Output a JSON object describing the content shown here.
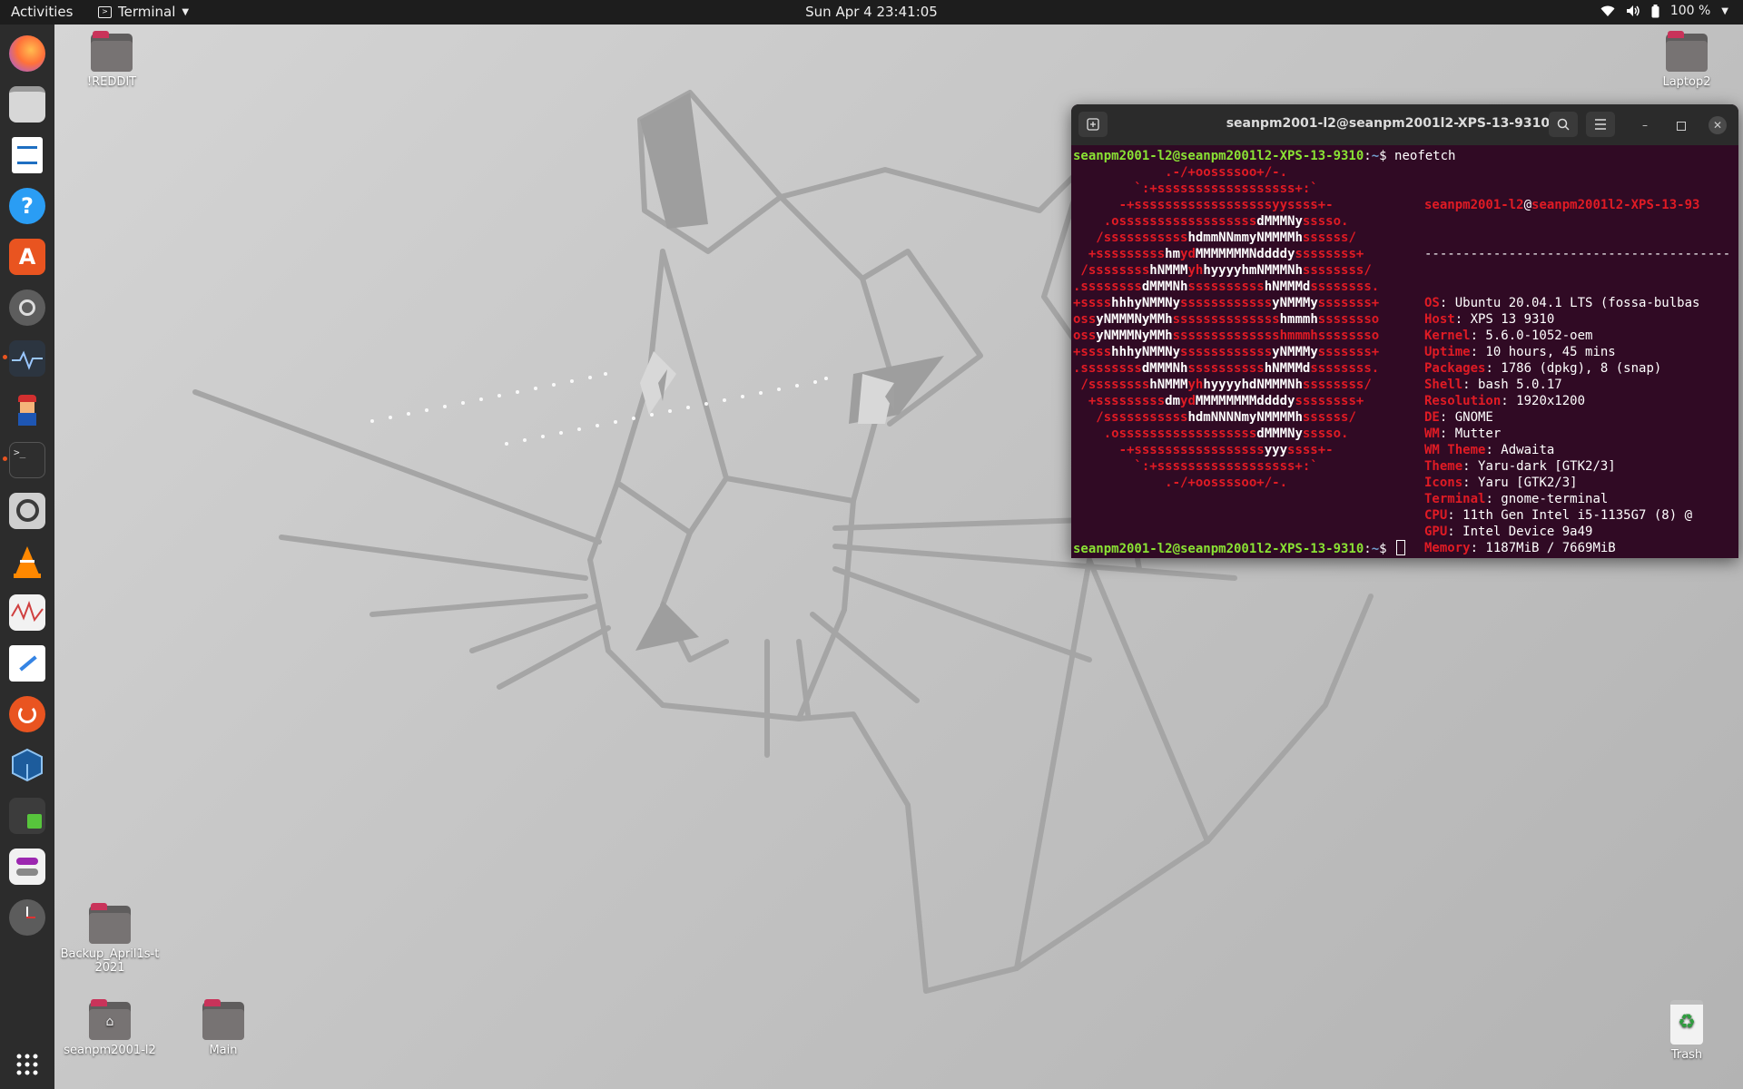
{
  "topbar": {
    "activities": "Activities",
    "app_name": "Terminal",
    "clock": "Sun Apr 4  23:41:05",
    "battery": "100 %"
  },
  "dock": {
    "apps": [
      "firefox-icon",
      "files-icon",
      "writer-icon",
      "help-icon",
      "software-icon",
      "settings-icon",
      "system-monitor-icon",
      "game-icon",
      "terminal-icon",
      "magnifier-icon",
      "vlc-icon",
      "stocks-icon",
      "text-editor-icon",
      "updates-icon",
      "virtualbox-icon",
      "extension-icon",
      "tweaks-icon",
      "clock-icon"
    ],
    "show_apps": "apps-grid-icon"
  },
  "desktop": {
    "icons": {
      "reddit": "!REDDIT",
      "laptop2": "Laptop2",
      "backup": "Backup_April1s-t2021",
      "home": "seanpm2001-l2",
      "main": "Main",
      "trash": "Trash"
    }
  },
  "terminal": {
    "title": "seanpm2001-l2@seanpm2001l2-XPS-13-9310: ~",
    "prompt_user": "seanpm2001-l2@seanpm2001l2-XPS-13-9310",
    "prompt_path": "~",
    "command": "neofetch",
    "header_user": "seanpm2001-l2",
    "header_at": "@",
    "header_host": "seanpm2001l2-XPS-13-93",
    "separator": "----------------------------------------",
    "info": [
      {
        "key": "OS",
        "value": ": Ubuntu 20.04.1 LTS (fossa-bulbas"
      },
      {
        "key": "Host",
        "value": ": XPS 13 9310"
      },
      {
        "key": "Kernel",
        "value": ": 5.6.0-1052-oem"
      },
      {
        "key": "Uptime",
        "value": ": 10 hours, 45 mins"
      },
      {
        "key": "Packages",
        "value": ": 1786 (dpkg), 8 (snap)"
      },
      {
        "key": "Shell",
        "value": ": bash 5.0.17"
      },
      {
        "key": "Resolution",
        "value": ": 1920x1200"
      },
      {
        "key": "DE",
        "value": ": GNOME"
      },
      {
        "key": "WM",
        "value": ": Mutter"
      },
      {
        "key": "WM Theme",
        "value": ": Adwaita"
      },
      {
        "key": "Theme",
        "value": ": Yaru-dark [GTK2/3]"
      },
      {
        "key": "Icons",
        "value": ": Yaru [GTK2/3]"
      },
      {
        "key": "Terminal",
        "value": ": gnome-terminal"
      },
      {
        "key": "CPU",
        "value": ": 11th Gen Intel i5-1135G7 (8) @"
      },
      {
        "key": "GPU",
        "value": ": Intel Device 9a49"
      },
      {
        "key": "Memory",
        "value": ": 1187MiB / 7669MiB"
      }
    ],
    "ascii_art": [
      [
        [
          "r",
          "            .-/+oossssoo+/-."
        ]
      ],
      [
        [
          "r",
          "        `:+ssssssssssssssssss+:`"
        ]
      ],
      [
        [
          "r",
          "      -+ssssssssssssssssssyyssss+-"
        ]
      ],
      [
        [
          "r",
          "    .ossssssssssssssssss"
        ],
        [
          "w",
          "dMMMNy"
        ],
        [
          "r",
          "sssso."
        ]
      ],
      [
        [
          "r",
          "   /sssssssssss"
        ],
        [
          "w",
          "hdmmNNmmyNMMMMh"
        ],
        [
          "r",
          "ssssss/"
        ]
      ],
      [
        [
          "r",
          "  +sssssssss"
        ],
        [
          "w",
          "hm"
        ],
        [
          "r",
          "yd"
        ],
        [
          "w",
          "MMMMMMMNddddy"
        ],
        [
          "r",
          "ssssssss+"
        ]
      ],
      [
        [
          "r",
          " /ssssssss"
        ],
        [
          "w",
          "hNMMM"
        ],
        [
          "r",
          "yh"
        ],
        [
          "w",
          "hyyyyhmNMMMNh"
        ],
        [
          "r",
          "ssssssss/"
        ]
      ],
      [
        [
          "r",
          ".ssssssss"
        ],
        [
          "w",
          "dMMMNh"
        ],
        [
          "r",
          "ssssssssss"
        ],
        [
          "w",
          "hNMMMd"
        ],
        [
          "r",
          "ssssssss."
        ]
      ],
      [
        [
          "r",
          "+ssss"
        ],
        [
          "w",
          "hhhyNMMNy"
        ],
        [
          "r",
          "ssssssssssss"
        ],
        [
          "w",
          "yNMMMy"
        ],
        [
          "r",
          "sssssss+"
        ]
      ],
      [
        [
          "r",
          "oss"
        ],
        [
          "w",
          "yNMMMNyMMh"
        ],
        [
          "r",
          "ssssssssssssss"
        ],
        [
          "w",
          "hmmmh"
        ],
        [
          "r",
          "ssssssso"
        ]
      ],
      [
        [
          "r",
          "oss"
        ],
        [
          "w",
          "yNMMMNyMMh"
        ],
        [
          "r",
          "sssssssssssssshmmmhssssssso"
        ]
      ],
      [
        [
          "r",
          "+ssss"
        ],
        [
          "w",
          "hhhyNMMNy"
        ],
        [
          "r",
          "ssssssssssss"
        ],
        [
          "w",
          "yNMMMy"
        ],
        [
          "r",
          "sssssss+"
        ]
      ],
      [
        [
          "r",
          ".ssssssss"
        ],
        [
          "w",
          "dMMMNh"
        ],
        [
          "r",
          "ssssssssss"
        ],
        [
          "w",
          "hNMMMd"
        ],
        [
          "r",
          "ssssssss."
        ]
      ],
      [
        [
          "r",
          " /ssssssss"
        ],
        [
          "w",
          "hNMMM"
        ],
        [
          "r",
          "yh"
        ],
        [
          "w",
          "hyyyyhdNMMMNh"
        ],
        [
          "r",
          "ssssssss/"
        ]
      ],
      [
        [
          "r",
          "  +sssssssss"
        ],
        [
          "w",
          "dm"
        ],
        [
          "r",
          "yd"
        ],
        [
          "w",
          "MMMMMMMMddddy"
        ],
        [
          "r",
          "ssssssss+"
        ]
      ],
      [
        [
          "r",
          "   /sssssssssss"
        ],
        [
          "w",
          "hdmNNNNmyNMMMMh"
        ],
        [
          "r",
          "ssssss/"
        ]
      ],
      [
        [
          "r",
          "    .ossssssssssssssssss"
        ],
        [
          "w",
          "dMMMNy"
        ],
        [
          "r",
          "sssso."
        ]
      ],
      [
        [
          "r",
          "      -+sssssssssssssssss"
        ],
        [
          "w",
          "yyy"
        ],
        [
          "r",
          "ssss+-"
        ]
      ],
      [
        [
          "r",
          "        `:+ssssssssssssssssss+:`"
        ]
      ],
      [
        [
          "r",
          "            .-/+oossssoo+/-."
        ]
      ]
    ],
    "palette_top": [
      "#3d3d3d",
      "#cc0000",
      "#4e9a06",
      "#c4a000",
      "#3465a4",
      "#75507b",
      "#06989a",
      "#d3d7cf"
    ],
    "palette_bottom": [
      "#555753",
      "#ef2929",
      "#8ae234",
      "#fce94f",
      "#729fcf",
      "#ad7fa8",
      "#34e2e2",
      "#eeeeec"
    ]
  }
}
